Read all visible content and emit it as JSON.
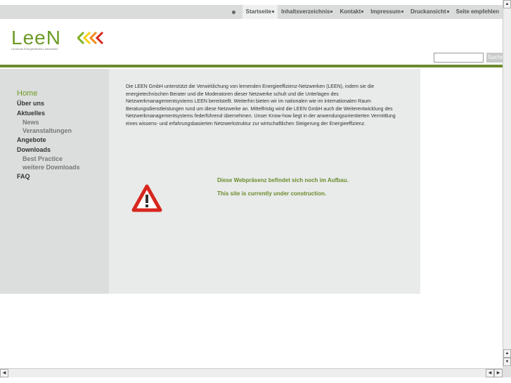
{
  "topnav": {
    "items": [
      {
        "label": "Startseite",
        "active": true
      },
      {
        "label": "Inhaltsverzeichnis",
        "active": false
      },
      {
        "label": "Kontakt",
        "active": false
      },
      {
        "label": "Impressum",
        "active": false
      },
      {
        "label": "Druckansicht",
        "active": false
      },
      {
        "label": "Seite empfehlen",
        "active": false
      }
    ]
  },
  "logo": {
    "text": "LeeN",
    "tagline": "Lernende Energieeffizienz-Netzwerke",
    "colors": [
      "#d7261e",
      "#f08a1c",
      "#f6d11a",
      "#7fb026"
    ]
  },
  "search": {
    "value": "",
    "button_label": "Suche"
  },
  "sidebar": {
    "items": [
      {
        "label": "Home",
        "level": 1,
        "active": true
      },
      {
        "label": "Über uns",
        "level": 1,
        "active": false
      },
      {
        "label": "Aktuelles",
        "level": 1,
        "active": false
      },
      {
        "label": "News",
        "level": 2,
        "active": false
      },
      {
        "label": "Veranstaltungen",
        "level": 2,
        "active": false
      },
      {
        "label": "Angebote",
        "level": 1,
        "active": false
      },
      {
        "label": "Downloads",
        "level": 1,
        "active": false
      },
      {
        "label": "Best Practice",
        "level": 2,
        "active": false
      },
      {
        "label": "weitere Downloads",
        "level": 2,
        "active": false
      },
      {
        "label": "FAQ",
        "level": 1,
        "active": false
      }
    ]
  },
  "content": {
    "intro": "Die LEEN GmbH unterstützt die Verwirklichung von lernenden Energieeffizienz-Netzwerken (LEEN), indem sie die energietechnischen Berater und die Moderatoren dieser Netzwerke schult und die Unterlagen des Netzwerkmanagementsystems LEEN bereitstellt. Weiterhin bieten wir im nationalen wie im internationalen Raum Beratungsdienstleistungen rund um diese Netzwerke an. Mittelfristig wird die LEEN GmbH auch die Weiterentwicklung des Netzwerkmanagementsystems federführend übernehmen. Unser Know-how liegt in der anwendungsorientierten Vermittlung eines wissens- und erfahrungsbasierten Netzwerkstruktur zur wirtschaftlichen Steigerung der Energieeffizienz.",
    "notice_de": "Diese Webpräsenz befindet sich noch im Aufbau.",
    "notice_en": "This site is currently under construction.",
    "warning_icon": "warning-triangle-icon"
  },
  "colors": {
    "brand_green": "#6d8b2c",
    "warning_red": "#d7261e"
  }
}
